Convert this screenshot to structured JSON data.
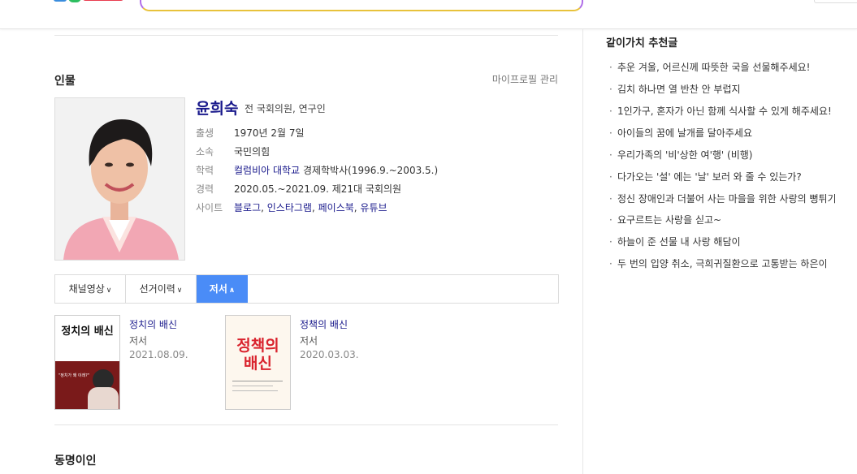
{
  "header": {
    "search_placeholder": ""
  },
  "person_section": {
    "title": "인물",
    "profile_manage": "마이프로필 관리",
    "name": "윤희숙",
    "desc": "전 국회의원, 연구인",
    "rows": [
      {
        "key": "출생",
        "value": "1970년 2월 7일"
      },
      {
        "key": "소속",
        "value": "국민의힘"
      },
      {
        "key": "학력",
        "link": "컬럼비아 대학교",
        "value": "경제학박사(1996.9.~2003.5.)"
      },
      {
        "key": "경력",
        "value": "2020.05.~2021.09. 제21대 국회의원"
      },
      {
        "key": "사이트",
        "links": [
          "블로그",
          "인스타그램",
          "페이스북",
          "유튜브"
        ]
      }
    ]
  },
  "tabs": [
    {
      "label": "채널영상",
      "chevron": "∨"
    },
    {
      "label": "선거이력",
      "chevron": "∨"
    },
    {
      "label": "저서",
      "chevron": "∧"
    }
  ],
  "books": [
    {
      "title": "정치의 배신",
      "role": "저서",
      "date": "2021.08.09.",
      "cover_title": "정치의 배신",
      "cover_quote": "\"정치가 왜 이래?\""
    },
    {
      "title": "정책의 배신",
      "role": "저서",
      "date": "2020.03.03.",
      "cover_title_1": "정책의",
      "cover_title_2": "배신"
    }
  ],
  "same_name": {
    "title": "동명이인"
  },
  "recommend": {
    "title": "같이가치 추천글",
    "items": [
      "추운 겨울, 어르신께 따뜻한 국을 선물해주세요!",
      "김치 하나면 열 반찬 안 부럽지",
      "1인가구, 혼자가 아닌 함께 식사할 수 있게 해주세요!",
      "아이들의 꿈에 날개를 달아주세요",
      "우리가족의 '비'상한 여'행' (비행)",
      "다가오는 '설' 에는 '날' 보러 와 줄 수 있는가?",
      "정신 장애인과 더불어 사는 마을을 위한 사랑의 뻥튀기",
      "요구르트는 사랑을 싣고~",
      "하늘이 준 선물 내 사랑 해담이",
      "두 번의 입양 취소, 극희귀질환으로 고통받는 하은이"
    ]
  },
  "colors": {
    "accent": "#4a8cf7",
    "link": "#1a1a8c"
  }
}
